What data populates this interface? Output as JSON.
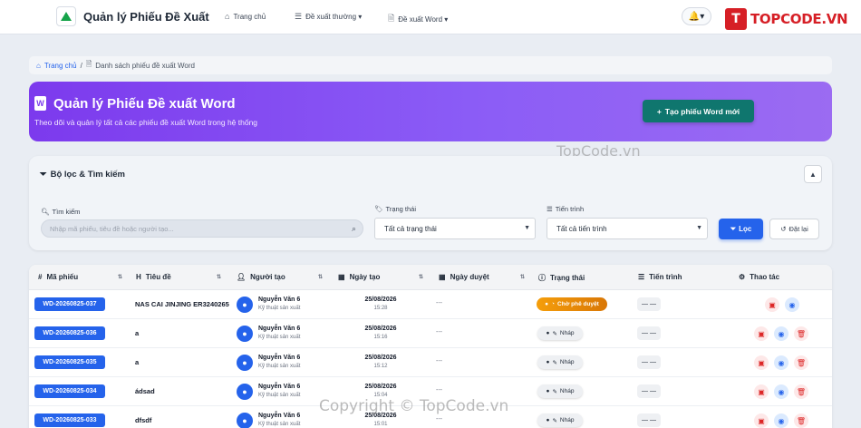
{
  "navbar": {
    "title": "Quản lý Phiếu Đề Xuất",
    "logo_text": "",
    "items": [
      {
        "label": "Trang chủ",
        "icon": "home-icon"
      },
      {
        "label": "Đề xuất thường ▾",
        "icon": "list-icon"
      },
      {
        "label": "Đề xuất Word ▾",
        "icon": "file-icon"
      }
    ],
    "bell": "🔔▾",
    "site_logo_text": "TOPCODE.VN"
  },
  "breadcrumb": {
    "home": "Trang chủ",
    "separator": "/",
    "current": "Danh sách phiếu đề xuất Word"
  },
  "hero": {
    "title": "Quản lý Phiếu Đề xuất Word",
    "subtitle": "Theo dõi và quản lý tất cả các phiếu đề xuất Word trong hệ thống",
    "create_button": "Tạo phiếu Word mới"
  },
  "filter": {
    "heading": "Bộ lọc & Tìm kiếm",
    "search_label": "Tìm kiếm",
    "search_placeholder": "Nhập mã phiếu, tiêu đề hoặc người tạo...",
    "status_label": "Trạng thái",
    "status_value": "Tất cả trạng thái",
    "progress_label": "Tiến trình",
    "progress_value": "Tất cả tiến trình",
    "filter_button": "Lọc",
    "reset_button": "Đặt lại"
  },
  "table": {
    "headers": {
      "code": "Mã phiếu",
      "title": "Tiêu đề",
      "creator": "Người tạo",
      "created": "Ngày tạo",
      "approved": "Ngày duyệt",
      "status": "Trạng thái",
      "progress": "Tiến trình",
      "actions": "Thao tác"
    },
    "rows": [
      {
        "code": "WD-20260825-037",
        "title": "NAS CAI JINJING ER3240265",
        "creator": "Nguyễn Văn 6",
        "dept": "Kỹ thuật sản xuất",
        "date": "25/08/2026",
        "time": "15:28",
        "approved": "---",
        "status": "Chờ phê duyệt",
        "progress": "— —"
      },
      {
        "code": "WD-20260825-036",
        "title": "a",
        "creator": "Nguyễn Văn 6",
        "dept": "Kỹ thuật sản xuất",
        "date": "25/08/2026",
        "time": "15:16",
        "approved": "---",
        "status": "Nháp",
        "progress": "— —"
      },
      {
        "code": "WD-20260825-035",
        "title": "a",
        "creator": "Nguyễn Văn 6",
        "dept": "Kỹ thuật sản xuất",
        "date": "25/08/2026",
        "time": "15:12",
        "approved": "---",
        "status": "Nháp",
        "progress": "— —"
      },
      {
        "code": "WD-20260825-034",
        "title": "ádsad",
        "creator": "Nguyễn Văn 6",
        "dept": "Kỹ thuật sản xuất",
        "date": "25/08/2026",
        "time": "15:04",
        "approved": "---",
        "status": "Nháp",
        "progress": "— —"
      },
      {
        "code": "WD-20260825-033",
        "title": "dfsdf",
        "creator": "Nguyễn Văn 6",
        "dept": "Kỹ thuật sản xuất",
        "date": "25/08/2026",
        "time": "15:01",
        "approved": "---",
        "status": "Nháp",
        "progress": "— —"
      }
    ]
  },
  "watermarks": {
    "top": "TopCode.vn",
    "bottom": "Copyright © TopCode.vn"
  }
}
